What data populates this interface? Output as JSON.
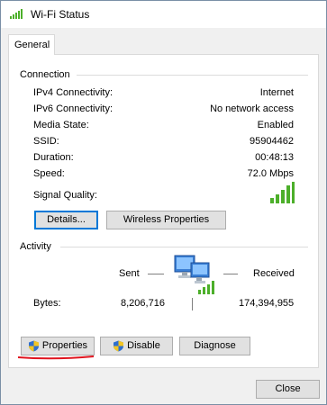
{
  "window": {
    "title": "Wi-Fi Status"
  },
  "tabs": [
    {
      "label": "General"
    }
  ],
  "connection": {
    "heading": "Connection",
    "rows": [
      {
        "label": "IPv4 Connectivity:",
        "value": "Internet"
      },
      {
        "label": "IPv6 Connectivity:",
        "value": "No network access"
      },
      {
        "label": "Media State:",
        "value": "Enabled"
      },
      {
        "label": "SSID:",
        "value": "95904462"
      },
      {
        "label": "Duration:",
        "value": "00:48:13"
      },
      {
        "label": "Speed:",
        "value": "72.0 Mbps"
      }
    ],
    "signal_label": "Signal Quality:",
    "signal_level": 1.0,
    "details_button": "Details...",
    "wireless_properties_button": "Wireless Properties"
  },
  "activity": {
    "heading": "Activity",
    "sent_label": "Sent",
    "received_label": "Received",
    "bytes_label": "Bytes:",
    "bytes_sent": "8,206,716",
    "bytes_received": "174,394,955"
  },
  "actions": {
    "properties": "Properties",
    "disable": "Disable",
    "diagnose": "Diagnose"
  },
  "close_button": "Close",
  "colors": {
    "signal_green": "#4caf2a",
    "focus_blue": "#0078d7",
    "annotation_red": "#e0141e"
  }
}
